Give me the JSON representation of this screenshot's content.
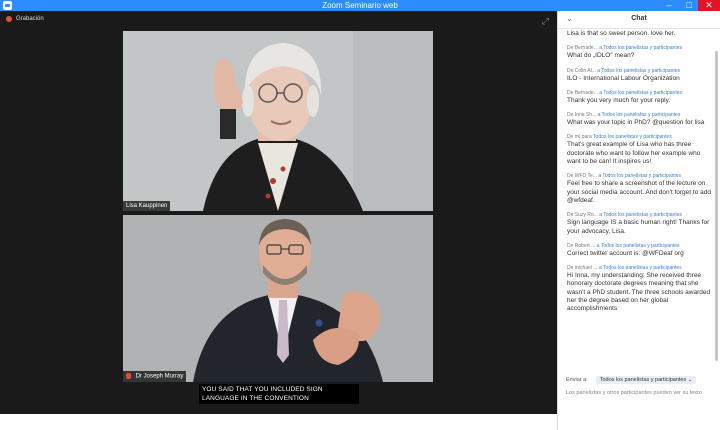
{
  "window": {
    "title": "Zoom Seminario web",
    "minimize": "‒",
    "maximize": "□",
    "close": "✕"
  },
  "recording": {
    "label": "Grabación"
  },
  "participants": [
    {
      "name": "Lisa Kauppinen"
    },
    {
      "name": "Dr Joseph Murray"
    }
  ],
  "caption": {
    "text": "YOU SAID THAT YOU INCLUDED SIGN LANGUAGE IN THE CONVENTION"
  },
  "chat": {
    "title": "Chat",
    "messages": [
      {
        "from": "",
        "to": "",
        "text": "Lisa is that so sweet person. love her."
      },
      {
        "from": "De Bernade...",
        "to": "a Todos los panelistas y participantes",
        "text": "What do „IDLO\" mean?"
      },
      {
        "from": "De Colin Al...",
        "to": "a Todos los panelistas y participantes",
        "text": "ILO - International Labour Organization"
      },
      {
        "from": "De Bernade...",
        "to": "a Todos los panelistas y participantes",
        "text": "Thank you very much for your reply."
      },
      {
        "from": "De Inna Sh...",
        "to": "a Todos los panelistas y participantes",
        "text": "What was your topic in PhD? @question for lisa"
      },
      {
        "from": "De mí para",
        "to": "Todos los panelistas y participantes",
        "text": "That's great example of Lisa who has three doctorate who want to follow her example who want to be can! It inspires us!"
      },
      {
        "from": "De WFD Te...",
        "to": "a Todos los panelistas y participantes",
        "text": "Feel free to share a screenshot of the lecture on your social media account. And don't forget to add @wfdeaf."
      },
      {
        "from": "De Suzy Ro...",
        "to": "a Todos los panelistas y participantes",
        "text": "Sign language IS a basic human right! Thanks for your advocacy, Lisa."
      },
      {
        "from": "De Robert ...",
        "to": "a Todos los panelistas y participantes",
        "text": "Correct twitter account is: @WFDeaf org"
      },
      {
        "from": "De michael ...",
        "to": "a Todos los panelistas y participantes",
        "text": "Hi Inna, my understanding: She received three honorary doctorate degrees meaning that she wasn't a PhD student. The three schools awarded her the degree based on her global accomplishments"
      }
    ],
    "send_to_label": "Enviar a:",
    "send_to_value": "Todos los panelistas y participantes",
    "input_placeholder": "Los panelistas y otros participantes pueden ver su texto"
  }
}
